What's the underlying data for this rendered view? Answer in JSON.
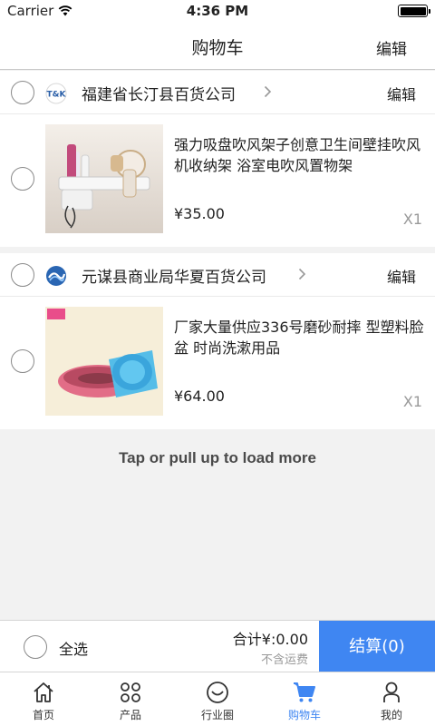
{
  "status_bar": {
    "carrier": "Carrier",
    "time": "4:36 PM"
  },
  "nav": {
    "title": "购物车",
    "edit": "编辑"
  },
  "shops": [
    {
      "name": "福建省长汀县百货公司",
      "edit": "编辑",
      "logo": "shop-logo-tk",
      "item": {
        "title": "强力吸盘吹风架子创意卫生间壁挂吹风机收纳架 浴室电吹风置物架",
        "price": "¥35.00",
        "qty": "X1"
      }
    },
    {
      "name": "元谋县商业局华夏百货公司",
      "edit": "编辑",
      "logo": "shop-logo-wave",
      "item": {
        "title": "厂家大量供应336号磨砂耐摔 型塑料脸盆 时尚洗漱用品",
        "price": "¥64.00",
        "qty": "X1"
      }
    }
  ],
  "load_more": "Tap or pull up to load more",
  "checkout": {
    "select_all": "全选",
    "total": "合计¥:0.00",
    "shipping_note": "不含运费",
    "button": "结算(0)"
  },
  "tabs": [
    {
      "label": "首页",
      "icon": "home-icon"
    },
    {
      "label": "产品",
      "icon": "products-icon"
    },
    {
      "label": "行业圈",
      "icon": "smile-icon"
    },
    {
      "label": "购物车",
      "icon": "cart-icon",
      "active": true
    },
    {
      "label": "我的",
      "icon": "user-icon"
    }
  ],
  "colors": {
    "accent": "#3f86f2",
    "background": "#f2f2f2",
    "muted": "#999999"
  }
}
